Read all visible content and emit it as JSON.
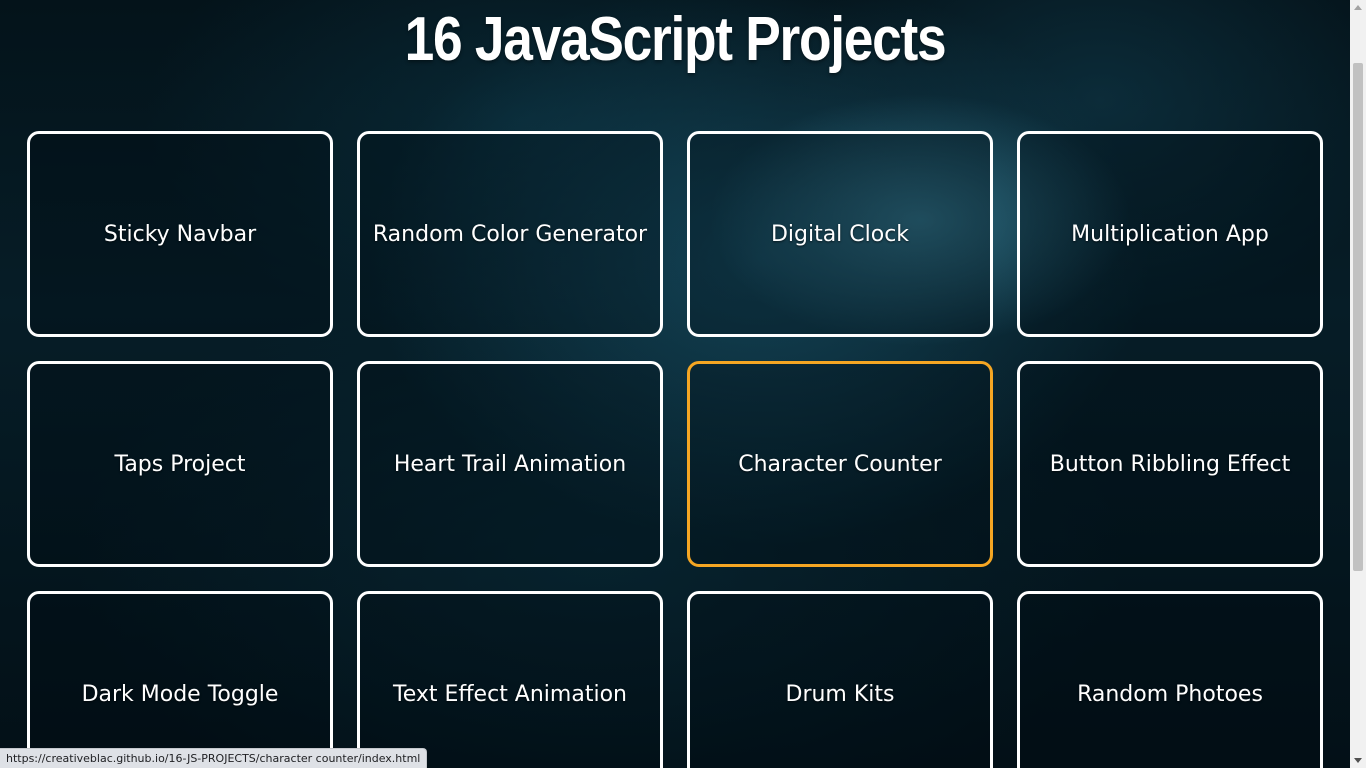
{
  "header": {
    "title": "16 JavaScript Projects"
  },
  "projects": [
    {
      "label": "Sticky Navbar"
    },
    {
      "label": "Random Color Generator"
    },
    {
      "label": "Digital Clock"
    },
    {
      "label": "Multiplication App"
    },
    {
      "label": "Taps Project"
    },
    {
      "label": "Heart Trail Animation"
    },
    {
      "label": "Character Counter"
    },
    {
      "label": "Button Ribbling Effect"
    },
    {
      "label": "Dark Mode Toggle"
    },
    {
      "label": "Text Effect Animation"
    },
    {
      "label": "Drum Kits"
    },
    {
      "label": "Random Photoes"
    }
  ],
  "status_bar": {
    "url": "https://creativeblac.github.io/16-JS-PROJECTS/character counter/index.html"
  },
  "colors": {
    "card_border": "#ffffff",
    "card_border_hover": "#f5a623",
    "background": "#061d27"
  }
}
